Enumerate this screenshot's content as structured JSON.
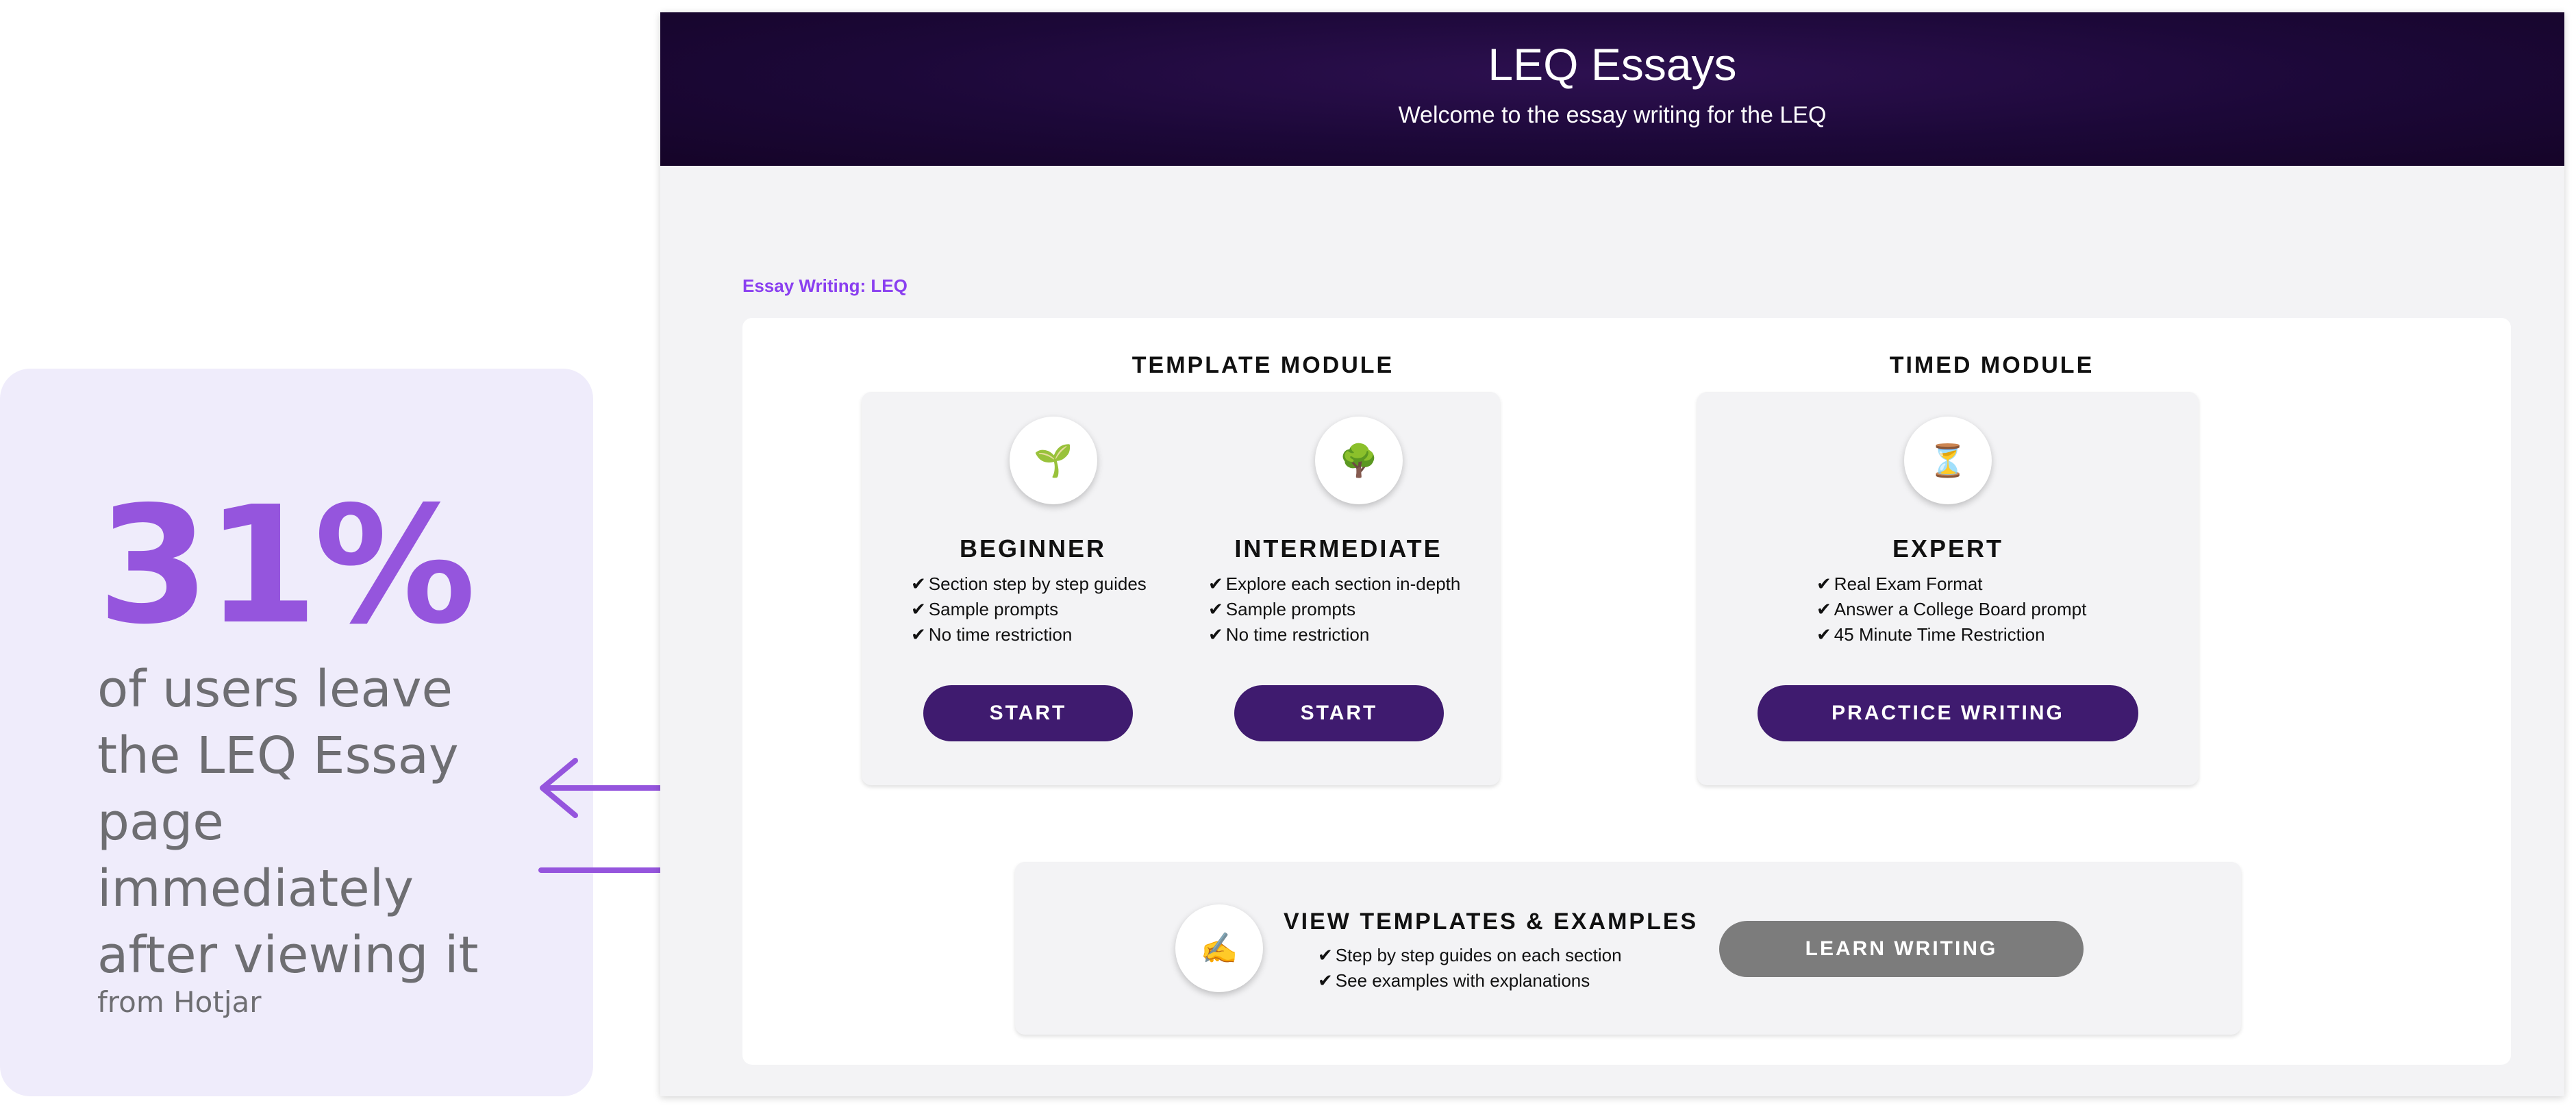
{
  "stat": {
    "number": "31%",
    "text": "of users leave the LEQ Essay page immediately after viewing it",
    "source": "from Hotjar",
    "accent_color": "#9555dd"
  },
  "app": {
    "title": "LEQ Essays",
    "subtitle": "Welcome to the essay writing for the LEQ",
    "breadcrumb": "Essay Writing: LEQ",
    "header_color": "#1c0838"
  },
  "template_module": {
    "heading": "TEMPLATE MODULE",
    "levels": [
      {
        "title": "BEGINNER",
        "icon": "seedling-icon",
        "glyph": "🌱",
        "features": [
          "Section step by step guides",
          "Sample prompts",
          "No time restriction"
        ],
        "button": "START"
      },
      {
        "title": "INTERMEDIATE",
        "icon": "tree-icon",
        "glyph": "🌳",
        "features": [
          "Explore each section in-depth",
          "Sample prompts",
          "No time restriction"
        ],
        "button": "START"
      }
    ]
  },
  "timed_module": {
    "heading": "TIMED MODULE",
    "level": {
      "title": "EXPERT",
      "icon": "hourglass-icon",
      "glyph": "⏳",
      "features": [
        "Real Exam Format",
        "Answer a College Board prompt",
        "45 Minute Time Restriction"
      ],
      "button": "PRACTICE WRITING"
    }
  },
  "templates": {
    "title": "VIEW TEMPLATES & EXAMPLES",
    "icon": "writing-hand-icon",
    "glyph": "✍️",
    "features": [
      "Step by step guides on each section",
      "See examples with explanations"
    ],
    "button": "LEARN WRITING"
  }
}
